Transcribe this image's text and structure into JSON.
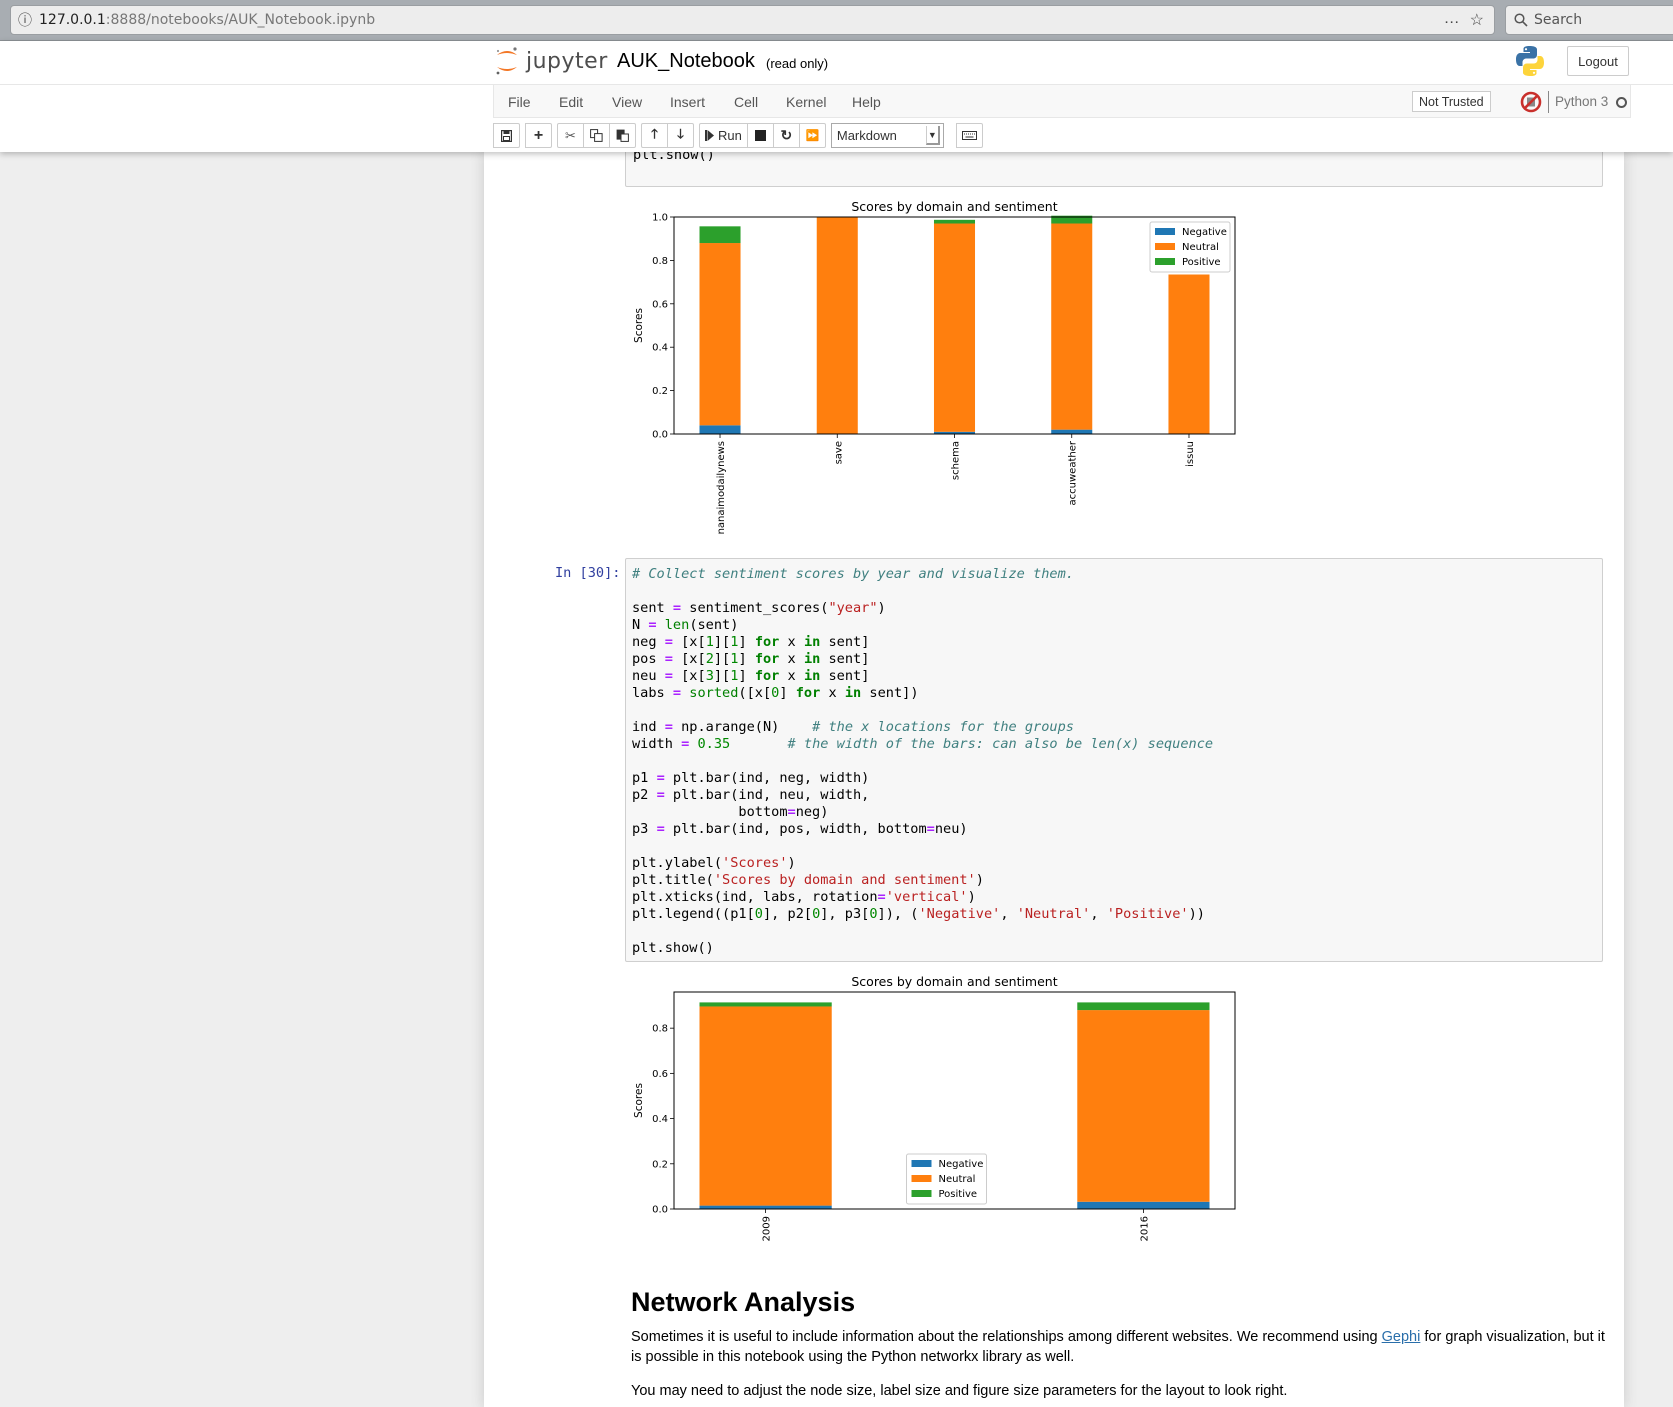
{
  "browser": {
    "url_host": "127.0.0.1",
    "url_rest": ":8888/notebooks/AUK_Notebook.ipynb",
    "search_placeholder": "Search",
    "more_icon": "…",
    "bookmark_icon": "☆"
  },
  "header": {
    "logo_text": "jupyter",
    "notebook_title": "AUK_Notebook",
    "read_only": "(read only)",
    "logout_label": "Logout"
  },
  "menubar": {
    "items": [
      "File",
      "Edit",
      "View",
      "Insert",
      "Cell",
      "Kernel",
      "Help"
    ],
    "trust_label": "Not Trusted",
    "kernel_name": "Python 3"
  },
  "toolbar": {
    "run_label": "Run",
    "cell_type": "Markdown"
  },
  "cells": {
    "prev_tail": "plt.show()",
    "cell30": {
      "prompt": "In [30]:",
      "lines": [
        [
          [
            "c",
            "# Collect sentiment scores by year and visualize them."
          ]
        ],
        [],
        [
          [
            "t",
            "sent "
          ],
          [
            "o",
            "="
          ],
          [
            "t",
            " sentiment_scores("
          ],
          [
            "s",
            "\"year\""
          ],
          [
            "t",
            ")"
          ]
        ],
        [
          [
            "t",
            "N "
          ],
          [
            "o",
            "="
          ],
          [
            "t",
            " "
          ],
          [
            "b",
            "len"
          ],
          [
            "t",
            "(sent)"
          ]
        ],
        [
          [
            "t",
            "neg "
          ],
          [
            "o",
            "="
          ],
          [
            "t",
            " [x["
          ],
          [
            "n",
            "1"
          ],
          [
            "t",
            "]["
          ],
          [
            "n",
            "1"
          ],
          [
            "t",
            "] "
          ],
          [
            "k",
            "for"
          ],
          [
            "t",
            " x "
          ],
          [
            "k",
            "in"
          ],
          [
            "t",
            " sent]"
          ]
        ],
        [
          [
            "t",
            "pos "
          ],
          [
            "o",
            "="
          ],
          [
            "t",
            " [x["
          ],
          [
            "n",
            "2"
          ],
          [
            "t",
            "]["
          ],
          [
            "n",
            "1"
          ],
          [
            "t",
            "] "
          ],
          [
            "k",
            "for"
          ],
          [
            "t",
            " x "
          ],
          [
            "k",
            "in"
          ],
          [
            "t",
            " sent]"
          ]
        ],
        [
          [
            "t",
            "neu "
          ],
          [
            "o",
            "="
          ],
          [
            "t",
            " [x["
          ],
          [
            "n",
            "3"
          ],
          [
            "t",
            "]["
          ],
          [
            "n",
            "1"
          ],
          [
            "t",
            "] "
          ],
          [
            "k",
            "for"
          ],
          [
            "t",
            " x "
          ],
          [
            "k",
            "in"
          ],
          [
            "t",
            " sent]"
          ]
        ],
        [
          [
            "t",
            "labs "
          ],
          [
            "o",
            "="
          ],
          [
            "t",
            " "
          ],
          [
            "b",
            "sorted"
          ],
          [
            "t",
            "([x["
          ],
          [
            "n",
            "0"
          ],
          [
            "t",
            "] "
          ],
          [
            "k",
            "for"
          ],
          [
            "t",
            " x "
          ],
          [
            "k",
            "in"
          ],
          [
            "t",
            " sent])"
          ]
        ],
        [],
        [
          [
            "t",
            "ind "
          ],
          [
            "o",
            "="
          ],
          [
            "t",
            " np.arange(N)    "
          ],
          [
            "c",
            "# the x locations for the groups"
          ]
        ],
        [
          [
            "t",
            "width "
          ],
          [
            "o",
            "="
          ],
          [
            "t",
            " "
          ],
          [
            "n",
            "0.35"
          ],
          [
            "t",
            "       "
          ],
          [
            "c",
            "# the width of the bars: can also be len(x) sequence"
          ]
        ],
        [],
        [
          [
            "t",
            "p1 "
          ],
          [
            "o",
            "="
          ],
          [
            "t",
            " plt.bar(ind, neg, width)"
          ]
        ],
        [
          [
            "t",
            "p2 "
          ],
          [
            "o",
            "="
          ],
          [
            "t",
            " plt.bar(ind, neu, width,"
          ]
        ],
        [
          [
            "t",
            "             bottom"
          ],
          [
            "o",
            "="
          ],
          [
            "t",
            "neg)"
          ]
        ],
        [
          [
            "t",
            "p3 "
          ],
          [
            "o",
            "="
          ],
          [
            "t",
            " plt.bar(ind, pos, width, bottom"
          ],
          [
            "o",
            "="
          ],
          [
            "t",
            "neu)"
          ]
        ],
        [],
        [
          [
            "t",
            "plt.ylabel("
          ],
          [
            "s",
            "'Scores'"
          ],
          [
            "t",
            ")"
          ]
        ],
        [
          [
            "t",
            "plt.title("
          ],
          [
            "s",
            "'Scores by domain and sentiment'"
          ],
          [
            "t",
            ")"
          ]
        ],
        [
          [
            "t",
            "plt.xticks(ind, labs, rotation"
          ],
          [
            "o",
            "="
          ],
          [
            "s",
            "'vertical'"
          ],
          [
            "t",
            ")"
          ]
        ],
        [
          [
            "t",
            "plt.legend((p1["
          ],
          [
            "n",
            "0"
          ],
          [
            "t",
            "], p2["
          ],
          [
            "n",
            "0"
          ],
          [
            "t",
            "], p3["
          ],
          [
            "n",
            "0"
          ],
          [
            "t",
            "]), ("
          ],
          [
            "s",
            "'Negative'"
          ],
          [
            "t",
            ", "
          ],
          [
            "s",
            "'Neutral'"
          ],
          [
            "t",
            ", "
          ],
          [
            "s",
            "'Positive'"
          ],
          [
            "t",
            "))"
          ]
        ],
        [],
        [
          [
            "t",
            "plt.show()"
          ]
        ]
      ]
    }
  },
  "colors": {
    "negative": "#1f77b4",
    "neutral": "#ff7f0e",
    "positive": "#2ca02c"
  },
  "chart_data": [
    {
      "type": "bar",
      "stacked": true,
      "title": "Scores by domain and sentiment",
      "xlabel": "",
      "ylabel": "Scores",
      "categories": [
        "nanaimodailynews",
        "save",
        "schema",
        "accuweather",
        "issuu"
      ],
      "series": [
        {
          "name": "Negative",
          "values": [
            0.04,
            0.0,
            0.01,
            0.02,
            0.0
          ]
        },
        {
          "name": "Neutral",
          "values": [
            0.84,
            1.0,
            0.96,
            0.95,
            0.735
          ]
        },
        {
          "name": "Positive",
          "values": [
            0.077,
            0.0,
            0.017,
            0.036,
            0.0
          ]
        }
      ],
      "stacking": "Neutral on Negative; Positive on Neutral",
      "ylim": [
        0,
        1.0
      ],
      "yticks": [
        "0.0",
        "0.2",
        "0.4",
        "0.6",
        "0.8",
        "1.0"
      ],
      "legend": "top-right",
      "grid": false
    },
    {
      "type": "bar",
      "stacked": true,
      "title": "Scores by domain and sentiment",
      "xlabel": "",
      "ylabel": "Scores",
      "categories": [
        "2009",
        "2016"
      ],
      "series": [
        {
          "name": "Negative",
          "values": [
            0.015,
            0.032
          ]
        },
        {
          "name": "Neutral",
          "values": [
            0.881,
            0.848
          ]
        },
        {
          "name": "Positive",
          "values": [
            0.018,
            0.034
          ]
        }
      ],
      "stacking": "Neutral on Negative; Positive on Neutral top",
      "ylim": [
        0,
        0.96
      ],
      "yticks": [
        "0.0",
        "0.2",
        "0.4",
        "0.6",
        "0.8"
      ],
      "legend": "lower-center",
      "grid": false
    }
  ],
  "markdown": {
    "heading": "Network Analysis",
    "p1_before": "Sometimes it is useful to include information about the relationships among different websites. We recommend using ",
    "p1_link": "Gephi",
    "p1_after": " for graph visualization, but it is possible in this notebook using the Python networkx library as well.",
    "p2": "You may need to adjust the node size, label size and figure size parameters for the layout to look right."
  }
}
